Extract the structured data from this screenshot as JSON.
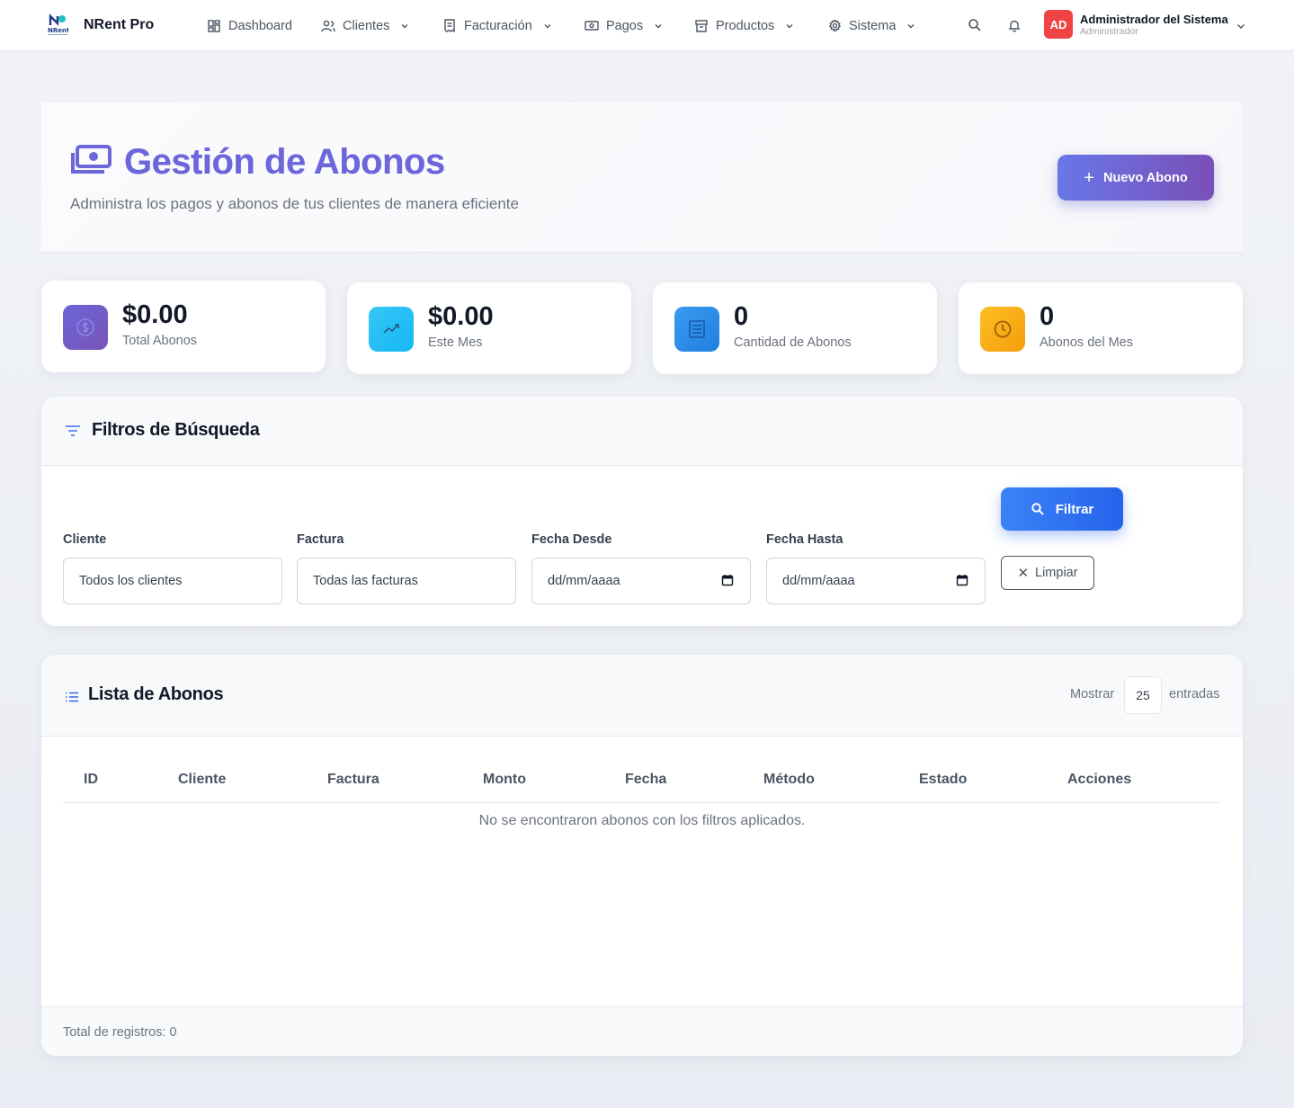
{
  "app": {
    "brand_logo_text": "NRent",
    "brand_name": "NRent Pro"
  },
  "nav": {
    "items": [
      {
        "label": "Dashboard",
        "icon": "dashboard-icon",
        "has_dropdown": false
      },
      {
        "label": "Clientes",
        "icon": "users-icon",
        "has_dropdown": true
      },
      {
        "label": "Facturación",
        "icon": "invoice-icon",
        "has_dropdown": true
      },
      {
        "label": "Pagos",
        "icon": "money-icon",
        "has_dropdown": true
      },
      {
        "label": "Productos",
        "icon": "box-icon",
        "has_dropdown": true
      },
      {
        "label": "Sistema",
        "icon": "gear-icon",
        "has_dropdown": true
      }
    ]
  },
  "user": {
    "initials": "AD",
    "name": "Administrador del Sistema",
    "role": "Administrador",
    "avatar_color": "#ef4444"
  },
  "header": {
    "title": "Gestión de Abonos",
    "subtitle": "Administra los pagos y abonos de tus clientes de manera eficiente",
    "new_button_label": "Nuevo Abono"
  },
  "stats": [
    {
      "value": "$0.00",
      "label": "Total Abonos",
      "icon": "money-circle-icon",
      "color_from": "#6c63d8",
      "color_to": "#7856b5"
    },
    {
      "value": "$0.00",
      "label": "Este Mes",
      "icon": "trend-up-icon",
      "color_from": "#38c6f5",
      "color_to": "#14b8f5"
    },
    {
      "value": "0",
      "label": "Cantidad de Abonos",
      "icon": "list-icon",
      "color_from": "#3b9bf0",
      "color_to": "#1f7fe0"
    },
    {
      "value": "0",
      "label": "Abonos del Mes",
      "icon": "clock-icon",
      "color_from": "#fbbf24",
      "color_to": "#f59e0b"
    }
  ],
  "filters": {
    "title": "Filtros de Búsqueda",
    "fields": [
      {
        "label": "Cliente",
        "value": "Todos los clientes",
        "type": "select"
      },
      {
        "label": "Factura",
        "value": "Todas las facturas",
        "type": "select"
      },
      {
        "label": "Fecha Desde",
        "value": "dd/mm/aaaa",
        "type": "date"
      },
      {
        "label": "Fecha Hasta",
        "value": "dd/mm/aaaa",
        "type": "date"
      }
    ],
    "filter_button_label": "Filtrar",
    "clear_button_label": "Limpiar"
  },
  "list": {
    "title": "Lista de Abonos",
    "show_label": "Mostrar",
    "page_size": "25",
    "entries_label": "entradas",
    "columns": [
      "ID",
      "Cliente",
      "Factura",
      "Monto",
      "Fecha",
      "Método",
      "Estado",
      "Acciones"
    ],
    "rows": [],
    "empty_message": "No se encontraron abonos con los filtros aplicados.",
    "total_label": "Total de registros: 0"
  }
}
